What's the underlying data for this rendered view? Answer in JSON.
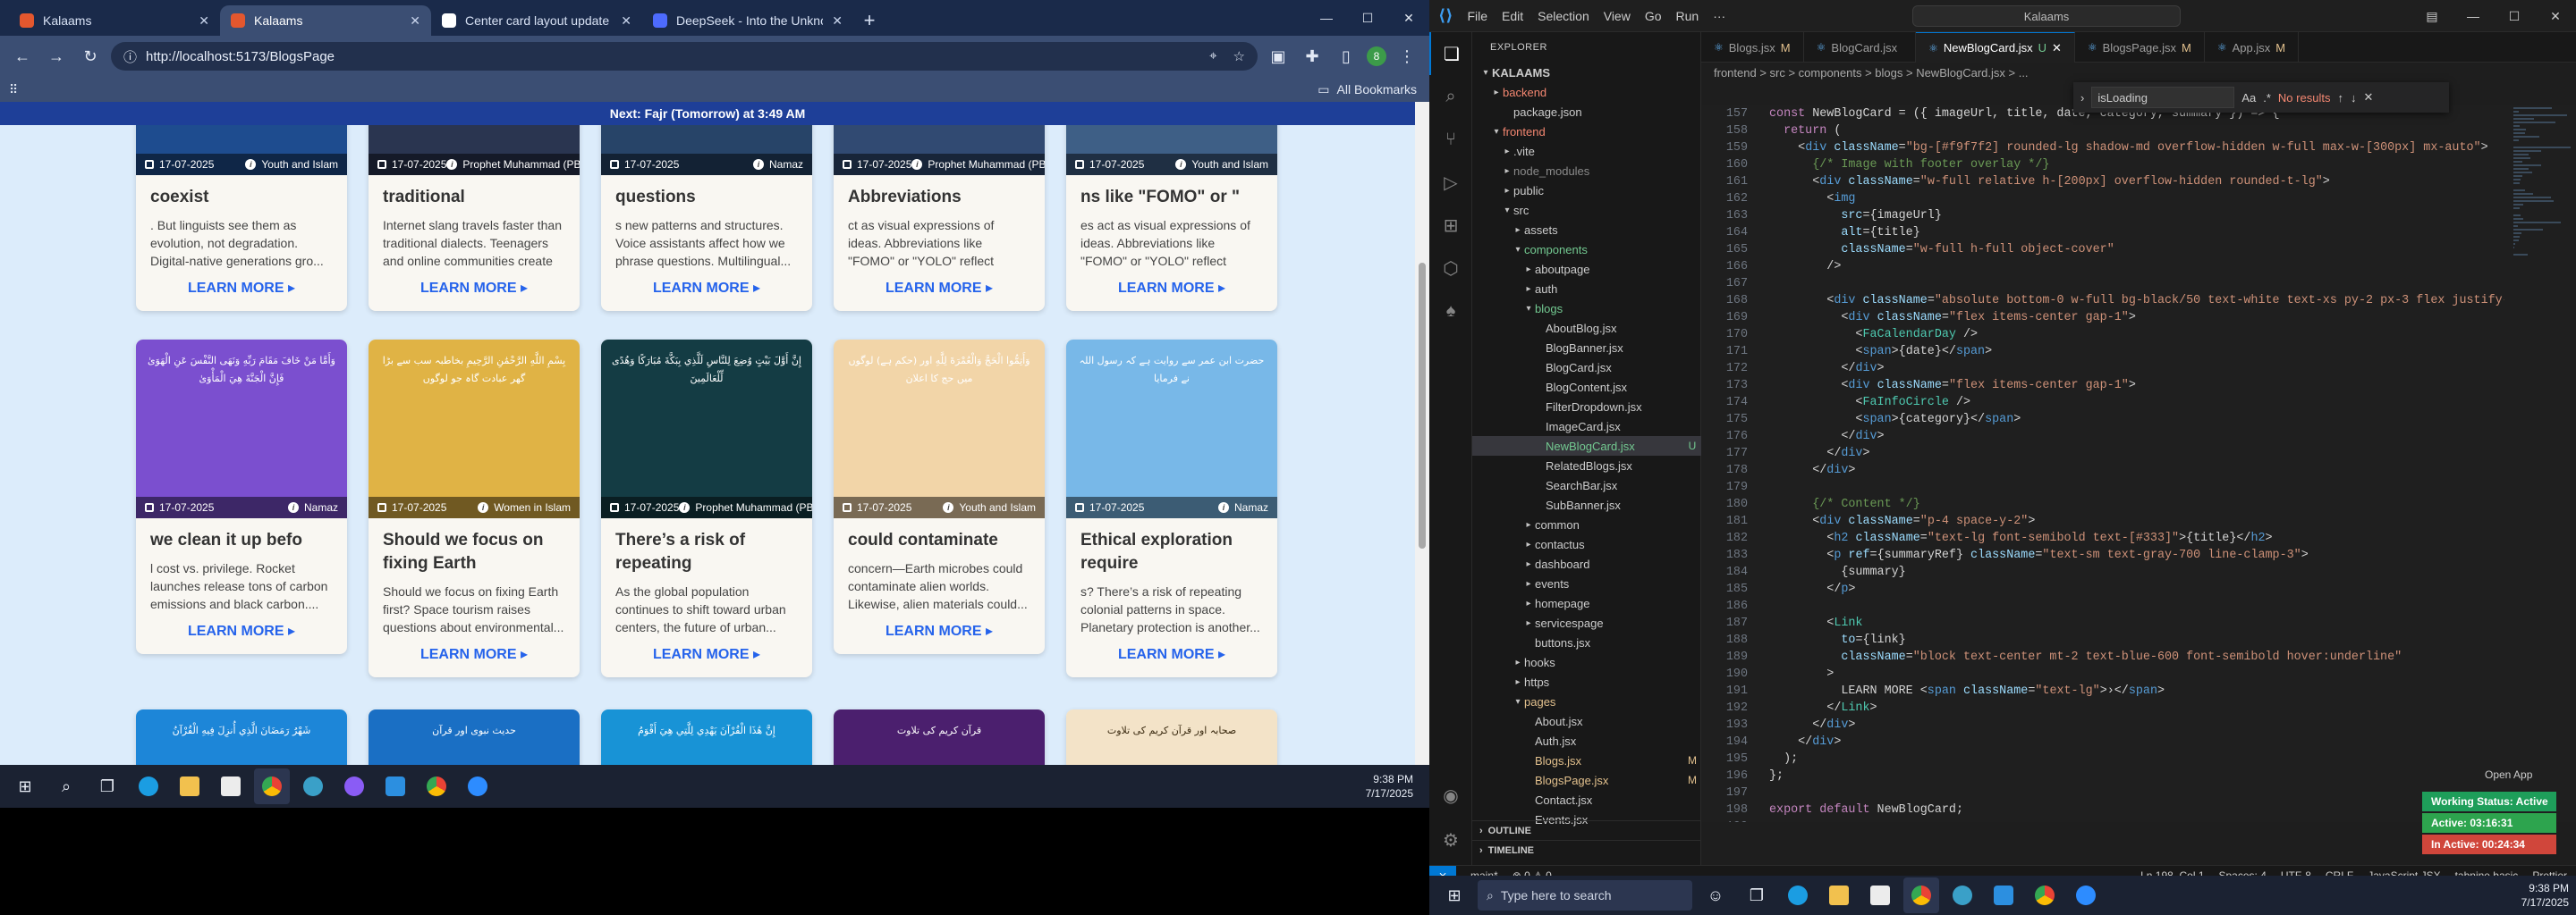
{
  "chrome": {
    "tabs": [
      {
        "title": "Kalaams",
        "fav": "#e4572e",
        "active": false
      },
      {
        "title": "Kalaams",
        "fav": "#e4572e",
        "active": true
      },
      {
        "title": "Center card layout update",
        "fav": "#ffffff",
        "active": false
      },
      {
        "title": "DeepSeek - Into the Unknown",
        "fav": "#4d6bfe",
        "active": false
      }
    ],
    "url": "http://localhost:5173/BlogsPage",
    "bookmarks": "All Bookmarks",
    "profile_initial": "8"
  },
  "page": {
    "banner": "Next: Fajr (Tomorrow) at 3:49 AM",
    "link_label": "LEARN MORE",
    "rows": [
      [
        {
          "date": "17-07-2025",
          "cat": "Youth and Islam",
          "title": "coexist",
          "summary": ". But linguists see them as evolution, not degradation. Digital-native generations gro...",
          "bg": "#1e4c8f"
        },
        {
          "date": "17-07-2025",
          "cat": "Prophet Muhammad (PBUH)",
          "title": "traditional",
          "summary": "Internet slang travels faster than traditional dialects. Teenagers and online communities create",
          "bg": "#2a3550"
        },
        {
          "date": "17-07-2025",
          "cat": "Namaz",
          "title": "questions",
          "summary": "s new patterns and structures. Voice assistants affect how we phrase questions. Multilingual...",
          "bg": "#274468"
        },
        {
          "date": "17-07-2025",
          "cat": "Prophet Muhammad (PBUH)",
          "title": "Abbreviations",
          "summary": "ct as visual expressions of ideas. Abbreviations like \"FOMO\" or \"YOLO\" reflect cultural shifts....",
          "bg": "#314a72"
        },
        {
          "date": "17-07-2025",
          "cat": "Youth and Islam",
          "title": "ns like \"FOMO\" or \"",
          "summary": "es act as visual expressions of ideas. Abbreviations like \"FOMO\" or \"YOLO\" reflect cultural shifts....",
          "bg": "#3e5f86"
        }
      ],
      [
        {
          "date": "17-07-2025",
          "cat": "Namaz",
          "title": "we clean it up befo",
          "summary": "l cost vs. privilege. Rocket launches release tons of carbon emissions and black carbon....",
          "bg": "#7b4fcf",
          "arabic": "وَأَمَّا مَنْ خَافَ مَقَامَ رَبِّهِ وَنَهَى النَّفْسَ عَنِ الْهَوَىٰ فَإِنَّ الْجَنَّةَ هِيَ الْمَأْوَىٰ"
        },
        {
          "date": "17-07-2025",
          "cat": "Women in Islam",
          "title": "Should we focus on fixing Earth",
          "summary": "Should we focus on fixing Earth first? Space tourism raises questions about environmental...",
          "bg": "#e0b345",
          "arabic": "بِسْمِ اللَّهِ الرَّحْمَٰنِ الرَّحِيمِ بخاطبہ سب سے بڑا گھر عبادت گاہ جو لوگوں"
        },
        {
          "date": "17-07-2025",
          "cat": "Prophet Muhammad (PBUH)",
          "title": "There’s a risk of repeating",
          "summary": "As the global population continues to shift toward urban centers, the future of urban...",
          "bg": "#143c44",
          "arabic": "إِنَّ أَوَّلَ بَيْتٍ وُضِعَ لِلنَّاسِ لَلَّذِي بِبَكَّةَ مُبَارَكًا وَهُدًى لِّلْعَالَمِينَ"
        },
        {
          "date": "17-07-2025",
          "cat": "Youth and Islam",
          "title": "could contaminate",
          "summary": "concern—Earth microbes could contaminate alien worlds. Likewise, alien materials could...",
          "bg": "#f2d5a8",
          "arabic": "وَأَتِمُّوا الْحَجَّ وَالْعُمْرَةَ لِلَّهِ اور (حکم ہے) لوگوں میں حج کا اعلان"
        },
        {
          "date": "17-07-2025",
          "cat": "Namaz",
          "title": "Ethical exploration require",
          "summary": "s? There’s a risk of repeating colonial patterns in space. Planetary protection is another...",
          "bg": "#78b8e8",
          "arabic": "حضرت ابن عمر سے روایت ہے کہ رسول اللہ نے فرمایا"
        }
      ],
      [
        {
          "bg": "#1d86d8",
          "arabic": "شَهْرُ رَمَضَانَ الَّذِي أُنزِلَ فِيهِ الْقُرْآنُ"
        },
        {
          "bg": "#1a6fc4",
          "arabic": "حدیث نبوی اور قرآن"
        },
        {
          "bg": "#1893d6",
          "arabic": "إِنَّ هَٰذَا الْقُرْآنَ يَهْدِي لِلَّتِي هِيَ أَقْوَمُ"
        },
        {
          "bg": "#4b1f6e",
          "arabic": "قرآن کریم کی تلاوت"
        },
        {
          "bg": "#f3e3c8",
          "arabic": "صحابہ اور قرآن کریم کی تلاوت",
          "dark": true
        }
      ]
    ]
  },
  "left_taskbar": {
    "time": "9:38 PM",
    "date": "7/17/2025"
  },
  "vscode": {
    "title_search": "Kalaams",
    "menu": [
      "File",
      "Edit",
      "Selection",
      "View",
      "Go",
      "Run",
      "···"
    ],
    "explorer_title": "EXPLORER",
    "tabs": [
      {
        "name": "Blogs.jsx",
        "flag": "M",
        "active": false
      },
      {
        "name": "BlogCard.jsx",
        "flag": "",
        "active": false
      },
      {
        "name": "NewBlogCard.jsx",
        "flag": "U",
        "active": true
      },
      {
        "name": "BlogsPage.jsx",
        "flag": "M",
        "active": false
      },
      {
        "name": "App.jsx",
        "flag": "M",
        "active": false
      }
    ],
    "breadcrumb": "frontend > src > components > blogs > NewBlogCard.jsx > ...",
    "find": {
      "query": "isLoading",
      "result": "No results"
    },
    "tree": [
      {
        "d": 0,
        "c": "▾",
        "n": "KALAAMS",
        "b": "",
        "bold": true
      },
      {
        "d": 1,
        "c": "▸",
        "n": "backend",
        "b": "",
        "cls": "red"
      },
      {
        "d": 2,
        "c": "",
        "n": "package.json",
        "b": ""
      },
      {
        "d": 1,
        "c": "▾",
        "n": "frontend",
        "b": "",
        "cls": "red"
      },
      {
        "d": 2,
        "c": "▸",
        "n": ".vite",
        "b": ""
      },
      {
        "d": 2,
        "c": "▸",
        "n": "node_modules",
        "b": "",
        "dim": true
      },
      {
        "d": 2,
        "c": "▸",
        "n": "public",
        "b": ""
      },
      {
        "d": 2,
        "c": "▾",
        "n": "src",
        "b": ""
      },
      {
        "d": 3,
        "c": "▸",
        "n": "assets",
        "b": ""
      },
      {
        "d": 3,
        "c": "▾",
        "n": "components",
        "b": "",
        "cls": "unt"
      },
      {
        "d": 4,
        "c": "▸",
        "n": "aboutpage",
        "b": ""
      },
      {
        "d": 4,
        "c": "▸",
        "n": "auth",
        "b": ""
      },
      {
        "d": 4,
        "c": "▾",
        "n": "blogs",
        "b": "",
        "cls": "unt"
      },
      {
        "d": 5,
        "c": "",
        "n": "AboutBlog.jsx",
        "b": ""
      },
      {
        "d": 5,
        "c": "",
        "n": "BlogBanner.jsx",
        "b": ""
      },
      {
        "d": 5,
        "c": "",
        "n": "BlogCard.jsx",
        "b": ""
      },
      {
        "d": 5,
        "c": "",
        "n": "BlogContent.jsx",
        "b": ""
      },
      {
        "d": 5,
        "c": "",
        "n": "FilterDropdown.jsx",
        "b": ""
      },
      {
        "d": 5,
        "c": "",
        "n": "ImageCard.jsx",
        "b": ""
      },
      {
        "d": 5,
        "c": "",
        "n": "NewBlogCard.jsx",
        "b": "U",
        "cls": "unt",
        "sel": true
      },
      {
        "d": 5,
        "c": "",
        "n": "RelatedBlogs.jsx",
        "b": ""
      },
      {
        "d": 5,
        "c": "",
        "n": "SearchBar.jsx",
        "b": ""
      },
      {
        "d": 5,
        "c": "",
        "n": "SubBanner.jsx",
        "b": ""
      },
      {
        "d": 4,
        "c": "▸",
        "n": "common",
        "b": ""
      },
      {
        "d": 4,
        "c": "▸",
        "n": "contactus",
        "b": ""
      },
      {
        "d": 4,
        "c": "▸",
        "n": "dashboard",
        "b": ""
      },
      {
        "d": 4,
        "c": "▸",
        "n": "events",
        "b": ""
      },
      {
        "d": 4,
        "c": "▸",
        "n": "homepage",
        "b": ""
      },
      {
        "d": 4,
        "c": "▸",
        "n": "servicespage",
        "b": ""
      },
      {
        "d": 4,
        "c": "",
        "n": "buttons.jsx",
        "b": ""
      },
      {
        "d": 3,
        "c": "▸",
        "n": "hooks",
        "b": ""
      },
      {
        "d": 3,
        "c": "▸",
        "n": "https",
        "b": ""
      },
      {
        "d": 3,
        "c": "▾",
        "n": "pages",
        "b": "",
        "cls": "mod"
      },
      {
        "d": 4,
        "c": "",
        "n": "About.jsx",
        "b": ""
      },
      {
        "d": 4,
        "c": "",
        "n": "Auth.jsx",
        "b": ""
      },
      {
        "d": 4,
        "c": "",
        "n": "Blogs.jsx",
        "b": "M",
        "cls": "mod"
      },
      {
        "d": 4,
        "c": "",
        "n": "BlogsPage.jsx",
        "b": "M",
        "cls": "mod"
      },
      {
        "d": 4,
        "c": "",
        "n": "Contact.jsx",
        "b": ""
      },
      {
        "d": 4,
        "c": "",
        "n": "Events.jsx",
        "b": ""
      }
    ],
    "outline": "OUTLINE",
    "timeline": "TIMELINE",
    "first_line": 157,
    "code": [
      "const NewBlogCard = ({ imageUrl, title, date, category, summary }) => {",
      "  return (",
      "    <div className=\"bg-[#f9f7f2] rounded-lg shadow-md overflow-hidden w-full max-w-[300px] mx-auto\">",
      "      {/* Image with footer overlay */}",
      "      <div className=\"w-full relative h-[200px] overflow-hidden rounded-t-lg\">",
      "        <img",
      "          src={imageUrl}",
      "          alt={title}",
      "          className=\"w-full h-full object-cover\"",
      "        />",
      "",
      "        <div className=\"absolute bottom-0 w-full bg-black/50 text-white text-xs py-2 px-3 flex justify-between\">",
      "          <div className=\"flex items-center gap-1\">",
      "            <FaCalendarDay />",
      "            <span>{date}</span>",
      "          </div>",
      "          <div className=\"flex items-center gap-1\">",
      "            <FaInfoCircle />",
      "            <span>{category}</span>",
      "          </div>",
      "        </div>",
      "      </div>",
      "",
      "      {/* Content */}",
      "      <div className=\"p-4 space-y-2\">",
      "        <h2 className=\"text-lg font-semibold text-[#333]\">{title}</h2>",
      "        <p ref={summaryRef} className=\"text-sm text-gray-700 line-clamp-3\">",
      "          {summary}",
      "        </p>",
      "",
      "        <Link",
      "          to={link}",
      "          className=\"block text-center mt-2 text-blue-600 font-semibold hover:underline\"",
      "        >",
      "          LEARN MORE <span className=\"text-lg\">›</span>",
      "        </Link>",
      "      </div>",
      "    </div>",
      "  );",
      "};",
      "",
      "export default NewBlogCard;",
      ""
    ],
    "status": {
      "branch": "main*",
      "problems": "⊗ 0 ⚠ 0",
      "pos": "Ln 198, Col 1",
      "spaces": "Spaces: 4",
      "enc": "UTF-8",
      "eol": "CRLF",
      "lang": "JavaScript JSX",
      "ext": "tabnine basic",
      "prettier": "Prettier"
    },
    "open_app": "Open App",
    "pops": [
      {
        "t": "Working Status: Active",
        "c": "#1e9e5a"
      },
      {
        "t": "Active: 03:16:31",
        "c": "#2da44e"
      },
      {
        "t": "In Active: 00:24:34",
        "c": "#d0463b"
      }
    ]
  },
  "right_taskbar": {
    "search": "Type here to search",
    "time": "9:38 PM",
    "date": "7/17/2025"
  }
}
